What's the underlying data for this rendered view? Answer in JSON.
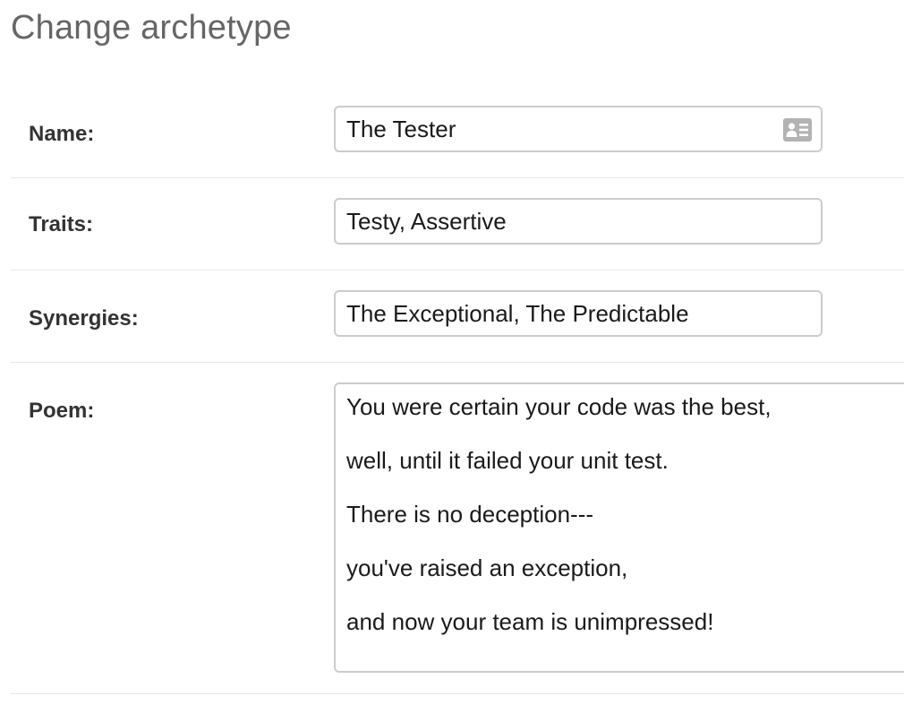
{
  "page": {
    "title": "Change archetype"
  },
  "form": {
    "name": {
      "label": "Name:",
      "value": "The Tester",
      "icon": "id-card-icon"
    },
    "traits": {
      "label": "Traits:",
      "value": "Testy, Assertive"
    },
    "synergies": {
      "label": "Synergies:",
      "value": "The Exceptional, The Predictable"
    },
    "poem": {
      "label": "Poem:",
      "lines": [
        "You were certain your code was the best,",
        "well, until it failed your unit test.",
        "There is no deception---",
        "you've raised an exception,",
        "and now your team is unimpressed!"
      ]
    }
  },
  "colors": {
    "title": "#666666",
    "label": "#333333",
    "border": "#cccccc",
    "divider": "#e6e6e6",
    "icon": "#b3b3b3"
  }
}
